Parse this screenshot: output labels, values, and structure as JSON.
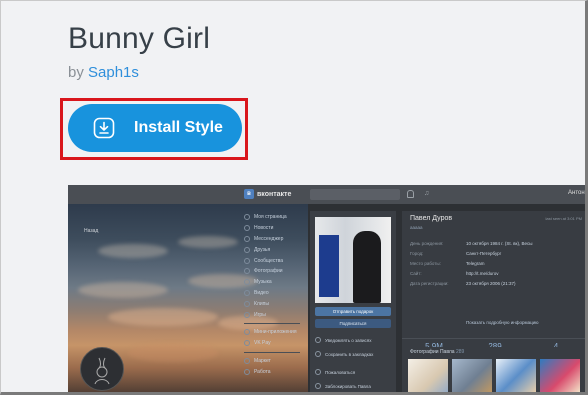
{
  "style": {
    "title": "Bunny Girl",
    "by_prefix": "by",
    "author": "Saph1s",
    "install_label": "Install Style"
  },
  "colors": {
    "accent": "#1893dd",
    "highlight_border": "#d9161c",
    "author_link": "#2f8fdb"
  },
  "preview": {
    "logo_text": "вконтакте",
    "user_short": "Антон",
    "home_link": "Назад",
    "menu": [
      "Моя страница",
      "Новости",
      "Мессенджер",
      "Друзья",
      "Сообщества",
      "Фотографии",
      "Музыка",
      "Видео",
      "Клипы",
      "Игры",
      "Мини-приложения",
      "VK Pay",
      "Маркет",
      "Работа"
    ],
    "profile": {
      "name": "Павел Дуров",
      "status": "ааааа",
      "online": "last seen at 3:01 PM",
      "fields": [
        {
          "k": "День рождения:",
          "v": "10 октября 1984 г. (St. вк), Весы"
        },
        {
          "k": "Город:",
          "v": "Санкт-Петербург"
        },
        {
          "k": "Место работы:",
          "v": "Telegram"
        },
        {
          "k": "Сайт:",
          "v": "http://t.me/durov"
        },
        {
          "k": "Дата регистрации:",
          "v": "23 октября 2006 (21:37)"
        }
      ],
      "show_more": "Показать подробную информацию",
      "stats": [
        {
          "n": "5.9M",
          "l": "подписчиков"
        },
        {
          "n": "289",
          "l": "фотографии"
        },
        {
          "n": "4",
          "l": "видеозаписи"
        }
      ]
    },
    "actions": {
      "send_gift": "Отправить подарок",
      "subscribe": "Подписаться",
      "notify": "Уведомлять о записях",
      "bookmark": "Сохранить в закладках",
      "report": "Пожаловаться",
      "block": "Заблокировать Павла"
    },
    "photos": {
      "title": "Фотографии Павла",
      "count": "289"
    }
  }
}
